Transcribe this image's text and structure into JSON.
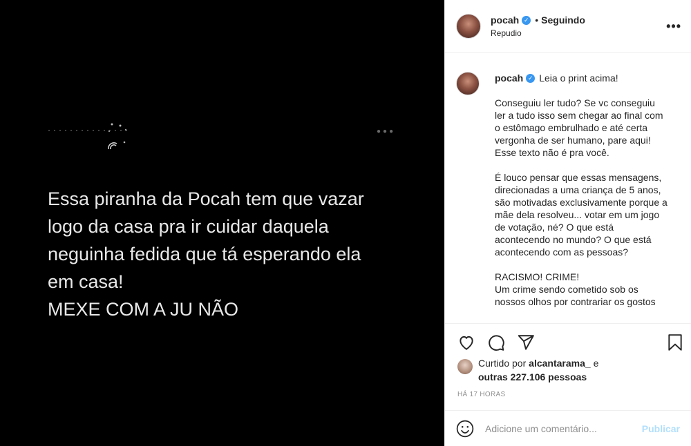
{
  "post": {
    "image_text": "Essa piranha da Pocah tem que vazar\nlogo da casa pra ir cuidar daquela\nneguinha fedida que tá esperando ela\nem casa!\nMEXE COM A JU NÃO",
    "background": "#000000"
  },
  "header": {
    "username": "pocah",
    "verified_icon": "verified-badge-icon",
    "separator": "•",
    "follow_status": "Seguindo",
    "subtitle": "Repudio",
    "options_icon": "more-options-icon"
  },
  "caption": {
    "username": "pocah",
    "lead": "Leia o print acima!",
    "paragraphs": [
      "Conseguiu ler tudo? Se vc conseguiu ler a tudo isso sem chegar ao final com o estômago embrulhado e até certa vergonha de ser humano, pare aqui! Esse texto não é pra você.",
      "É louco pensar que essas mensagens, direcionadas a uma criança de 5 anos, são motivadas exclusivamente porque a mãe dela resolveu... votar em um jogo de votação, né? O que está acontecendo no mundo? O que está acontecendo com as pessoas?",
      "RACISMO! CRIME!\nUm crime sendo cometido sob os nossos olhos por contrariar os gostos"
    ]
  },
  "actions": {
    "icons": [
      "heart-icon",
      "comment-icon",
      "share-icon",
      "bookmark-icon"
    ]
  },
  "likes": {
    "prefix": "Curtido por",
    "user": "alcantarama_",
    "connector": "e",
    "others": "outras 227.106 pessoas"
  },
  "timestamp": "HÁ 17 HORAS",
  "comment": {
    "placeholder": "Adicione um comentário...",
    "publish_label": "Publicar",
    "publish_color": "#b2dffc"
  },
  "colors": {
    "verified": "#3897f0",
    "text": "#262626",
    "muted": "#8e8e8e",
    "divider": "#efefef"
  }
}
